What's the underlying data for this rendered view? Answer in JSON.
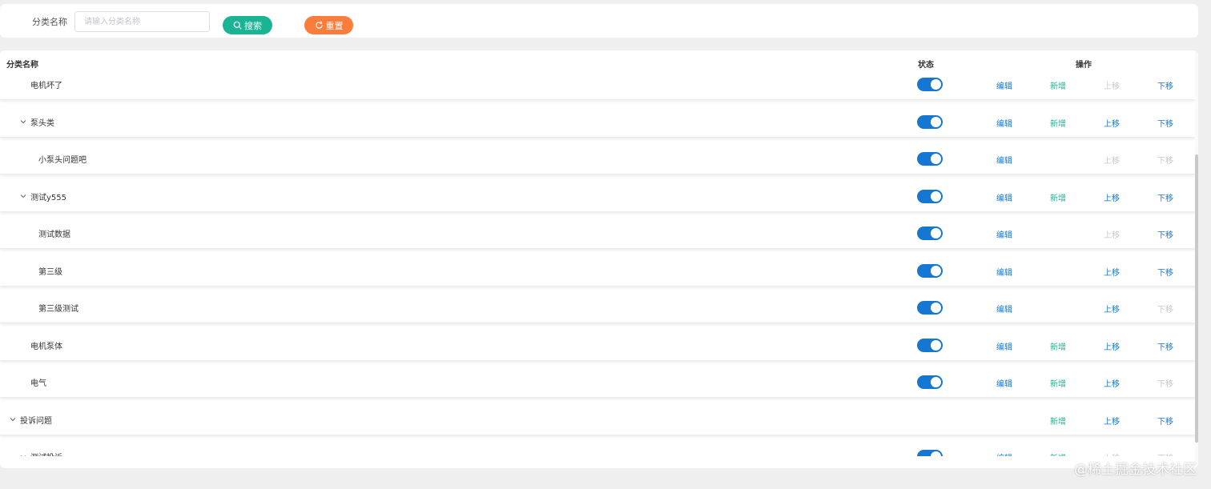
{
  "search": {
    "label": "分类名称",
    "placeholder": "请输入分类名称",
    "value": "",
    "search_button": "搜索",
    "reset_button": "重置"
  },
  "table": {
    "columns": {
      "name": "分类名称",
      "status": "状态",
      "actions": "操作"
    },
    "action_labels": {
      "edit": "编辑",
      "add": "新增",
      "up": "上移",
      "down": "下移"
    },
    "rows": [
      {
        "name": "电机坏了",
        "level": 2,
        "expandable": false,
        "status_on": true,
        "show_edit": true,
        "show_add": true,
        "up_enabled": false,
        "down_enabled": true
      },
      {
        "name": "泵头类",
        "level": 2,
        "expandable": true,
        "status_on": true,
        "show_edit": true,
        "show_add": true,
        "up_enabled": true,
        "down_enabled": true
      },
      {
        "name": "小泵头问题吧",
        "level": 3,
        "expandable": false,
        "status_on": true,
        "show_edit": true,
        "show_add": false,
        "up_enabled": false,
        "down_enabled": false
      },
      {
        "name": "测试y555",
        "level": 2,
        "expandable": true,
        "status_on": true,
        "show_edit": true,
        "show_add": true,
        "up_enabled": true,
        "down_enabled": true
      },
      {
        "name": "测试数据",
        "level": 3,
        "expandable": false,
        "status_on": true,
        "show_edit": true,
        "show_add": false,
        "up_enabled": false,
        "down_enabled": true
      },
      {
        "name": "第三级",
        "level": 3,
        "expandable": false,
        "status_on": true,
        "show_edit": true,
        "show_add": false,
        "up_enabled": true,
        "down_enabled": true
      },
      {
        "name": "第三级测试",
        "level": 3,
        "expandable": false,
        "status_on": true,
        "show_edit": true,
        "show_add": false,
        "up_enabled": true,
        "down_enabled": false
      },
      {
        "name": "电机泵体",
        "level": 2,
        "expandable": false,
        "status_on": true,
        "show_edit": true,
        "show_add": true,
        "up_enabled": true,
        "down_enabled": true
      },
      {
        "name": "电气",
        "level": 2,
        "expandable": false,
        "status_on": true,
        "show_edit": true,
        "show_add": true,
        "up_enabled": true,
        "down_enabled": false
      },
      {
        "name": "投诉问题",
        "level": 1,
        "expandable": true,
        "status_on": null,
        "show_edit": false,
        "show_add": true,
        "up_enabled": true,
        "down_enabled": true
      },
      {
        "name": "测试投诉",
        "level": 2,
        "expandable": true,
        "status_on": true,
        "show_edit": true,
        "show_add": true,
        "up_enabled": false,
        "down_enabled": false
      }
    ]
  },
  "colors": {
    "primary": "#1677d2",
    "success": "#1ab394",
    "warning": "#fa7d3c",
    "disabled": "#c8c8c8"
  },
  "icons": {
    "search_button": "search-icon",
    "reset_button": "refresh-icon",
    "expand": "chevron-down-icon"
  },
  "watermark": "@稀土掘金技术社区"
}
